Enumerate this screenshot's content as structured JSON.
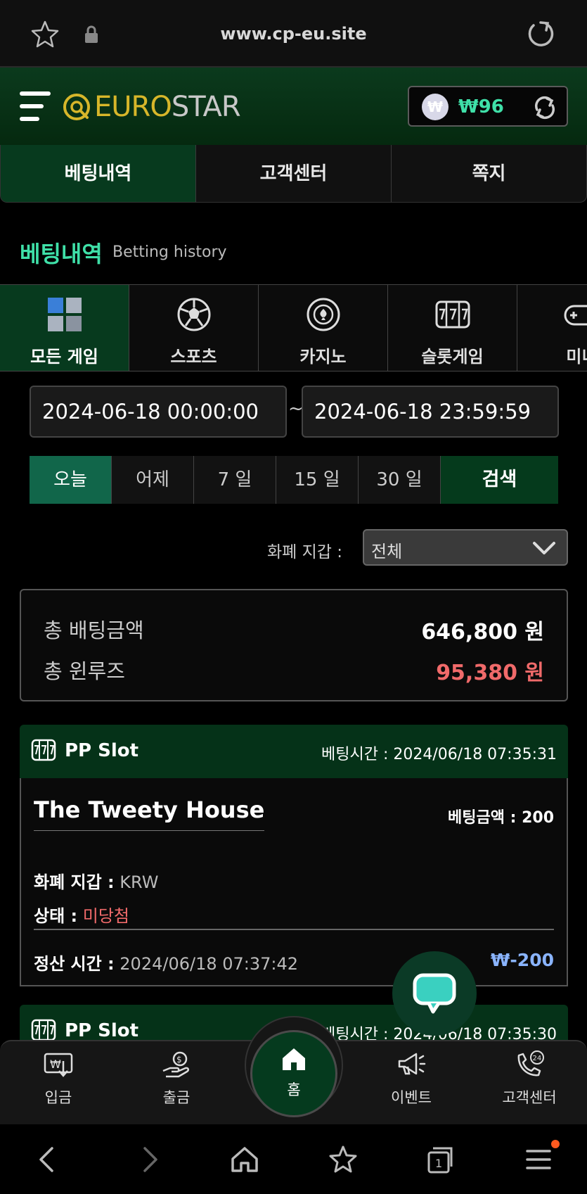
{
  "browser": {
    "url": "www.cp-eu.site"
  },
  "header": {
    "logo_part1": "EURO",
    "logo_part2": "STAR",
    "wallet_coin_symbol": "₩",
    "wallet_balance": "₩96"
  },
  "top_tabs": [
    {
      "label": "베팅내역",
      "active": true
    },
    {
      "label": "고객센터",
      "active": false
    },
    {
      "label": "쪽지",
      "active": false
    }
  ],
  "page": {
    "title": "베팅내역",
    "subtitle": "Betting history"
  },
  "categories": [
    {
      "label": "모든 게임",
      "icon": "cubes-icon",
      "active": true
    },
    {
      "label": "스포츠",
      "icon": "soccer-ball-icon"
    },
    {
      "label": "카지노",
      "icon": "casino-chip-icon"
    },
    {
      "label": "슬롯게임",
      "icon": "slot-777-icon"
    },
    {
      "label": "미니",
      "icon": "gamepad-icon"
    }
  ],
  "date_range": {
    "from": "2024-06-18 00:00:00",
    "separator": "~",
    "to": "2024-06-18 23:59:59"
  },
  "periods": {
    "today": "오늘",
    "yesterday": "어제",
    "d7": "7 일",
    "d15": "15 일",
    "d30": "30 일",
    "search": "검색"
  },
  "currency": {
    "label": "화폐 지갑 :",
    "selected": "전체"
  },
  "totals": {
    "bet_label": "총 배팅금액",
    "bet_value": "646,800 원",
    "winloss_label": "총 윈루즈",
    "winloss_value": "95,380 원"
  },
  "bets": [
    {
      "provider": "PP Slot",
      "bet_time": "베팅시간 : 2024/06/18 07:35:31",
      "game": "The Tweety House",
      "bet_amount": "베팅금액 : 200",
      "wallet_label": "화폐 지갑 :",
      "wallet_value": "KRW",
      "status_label": "상태 :",
      "status_value": "미당첨",
      "settle_label": "정산 시간 :",
      "settle_value": "2024/06/18 07:37:42",
      "result": "₩-200"
    },
    {
      "provider": "PP Slot",
      "bet_time": "베팅시간 : 2024/06/18 07:35:30"
    }
  ],
  "bottom_nav": {
    "deposit": "입금",
    "withdraw": "출금",
    "home": "홈",
    "event": "이벤트",
    "support": "고객센터"
  },
  "colors": {
    "accent_green": "#3fe0a8",
    "header_green": "#053218",
    "loss_red": "#f06a6a",
    "result_blue": "#8ab4ff"
  }
}
